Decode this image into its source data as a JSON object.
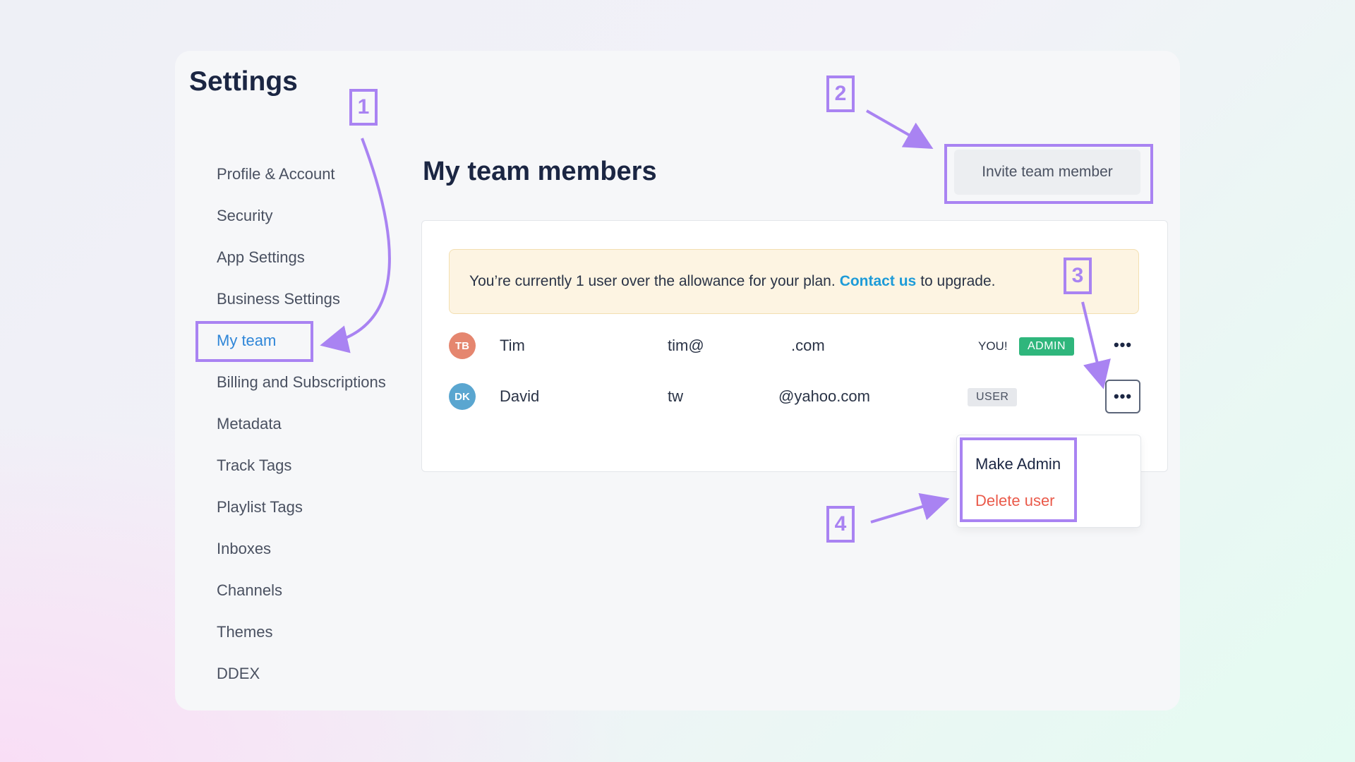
{
  "settings_title": "Settings",
  "sidebar": {
    "items": [
      {
        "label": "Profile & Account"
      },
      {
        "label": "Security"
      },
      {
        "label": "App Settings"
      },
      {
        "label": "Business Settings"
      },
      {
        "label": "My team",
        "active": true
      },
      {
        "label": "Billing and Subscriptions"
      },
      {
        "label": "Metadata"
      },
      {
        "label": "Track Tags"
      },
      {
        "label": "Playlist Tags"
      },
      {
        "label": "Inboxes"
      },
      {
        "label": "Channels"
      },
      {
        "label": "Themes"
      },
      {
        "label": "DDEX"
      }
    ]
  },
  "main": {
    "title": "My team members",
    "invite_button": "Invite team member",
    "alert": {
      "text_before": "You’re currently 1 user over the allowance for your plan.",
      "link": "Contact us",
      "text_after": "to upgrade."
    },
    "members": [
      {
        "initials": "TB",
        "avatar_color": "#e5866f",
        "name": "Tim",
        "email_start": "tim@",
        "email_end": ".com",
        "you": "YOU!",
        "role": "ADMIN"
      },
      {
        "initials": "DK",
        "avatar_color": "#5aa6d0",
        "name": "David",
        "email_start": "tw",
        "email_end": "@yahoo.com",
        "role": "USER"
      }
    ],
    "more_icon": "•••",
    "menu": {
      "make_admin": "Make Admin",
      "delete_user": "Delete user"
    }
  },
  "annotations": {
    "n1": "1",
    "n2": "2",
    "n3": "3",
    "n4": "4"
  },
  "colors": {
    "accent": "#2f86d8",
    "annotation": "#a983f2",
    "admin": "#2fb67c",
    "danger": "#ea5a4a",
    "link": "#1d9bd8"
  }
}
